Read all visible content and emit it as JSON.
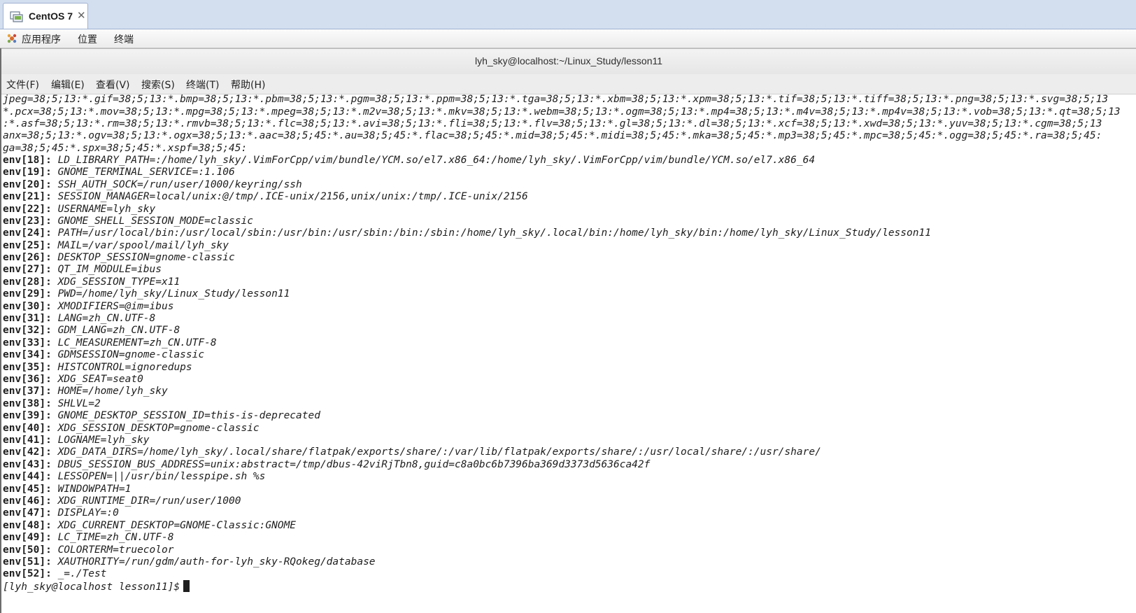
{
  "vm_tab": {
    "label": "CentOS 7",
    "close_glyph": "✕"
  },
  "gnome_topbar": {
    "menus": [
      {
        "label": "应用程序",
        "icon": "applications-icon"
      },
      {
        "label": "位置"
      },
      {
        "label": "终端"
      }
    ]
  },
  "window": {
    "title": "lyh_sky@localhost:~/Linux_Study/lesson11"
  },
  "menubar": {
    "items": [
      "文件(F)",
      "编辑(E)",
      "查看(V)",
      "搜索(S)",
      "终端(T)",
      "帮助(H)"
    ]
  },
  "terminal": {
    "wrapped_lines": [
      "jpeg=38;5;13:*.gif=38;5;13:*.bmp=38;5;13:*.pbm=38;5;13:*.pgm=38;5;13:*.ppm=38;5;13:*.tga=38;5;13:*.xbm=38;5;13:*.xpm=38;5;13:*.tif=38;5;13:*.tiff=38;5;13:*.png=38;5;13:*.svg=38;5;13",
      "*.pcx=38;5;13:*.mov=38;5;13:*.mpg=38;5;13:*.mpeg=38;5;13:*.m2v=38;5;13:*.mkv=38;5;13:*.webm=38;5;13:*.ogm=38;5;13:*.mp4=38;5;13:*.m4v=38;5;13:*.mp4v=38;5;13:*.vob=38;5;13:*.qt=38;5;13",
      ":*.asf=38;5;13:*.rm=38;5;13:*.rmvb=38;5;13:*.flc=38;5;13:*.avi=38;5;13:*.fli=38;5;13:*.flv=38;5;13:*.gl=38;5;13:*.dl=38;5;13:*.xcf=38;5;13:*.xwd=38;5;13:*.yuv=38;5;13:*.cgm=38;5;13",
      "anx=38;5;13:*.ogv=38;5;13:*.ogx=38;5;13:*.aac=38;5;45:*.au=38;5;45:*.flac=38;5;45:*.mid=38;5;45:*.midi=38;5;45:*.mka=38;5;45:*.mp3=38;5;45:*.mpc=38;5;45:*.ogg=38;5;45:*.ra=38;5;45:",
      "ga=38;5;45:*.spx=38;5;45:*.xspf=38;5;45:"
    ],
    "env_lines": [
      {
        "idx": "env[18]: ",
        "value": "LD_LIBRARY_PATH=:/home/lyh_sky/.VimForCpp/vim/bundle/YCM.so/el7.x86_64:/home/lyh_sky/.VimForCpp/vim/bundle/YCM.so/el7.x86_64"
      },
      {
        "idx": "env[19]: ",
        "value": "GNOME_TERMINAL_SERVICE=:1.106"
      },
      {
        "idx": "env[20]: ",
        "value": "SSH_AUTH_SOCK=/run/user/1000/keyring/ssh"
      },
      {
        "idx": "env[21]: ",
        "value": "SESSION_MANAGER=local/unix:@/tmp/.ICE-unix/2156,unix/unix:/tmp/.ICE-unix/2156"
      },
      {
        "idx": "env[22]: ",
        "value": "USERNAME=lyh_sky"
      },
      {
        "idx": "env[23]: ",
        "value": "GNOME_SHELL_SESSION_MODE=classic"
      },
      {
        "idx": "env[24]: ",
        "value": "PATH=/usr/local/bin:/usr/local/sbin:/usr/bin:/usr/sbin:/bin:/sbin:/home/lyh_sky/.local/bin:/home/lyh_sky/bin:/home/lyh_sky/Linux_Study/lesson11"
      },
      {
        "idx": "env[25]: ",
        "value": "MAIL=/var/spool/mail/lyh_sky"
      },
      {
        "idx": "env[26]: ",
        "value": "DESKTOP_SESSION=gnome-classic"
      },
      {
        "idx": "env[27]: ",
        "value": "QT_IM_MODULE=ibus"
      },
      {
        "idx": "env[28]: ",
        "value": "XDG_SESSION_TYPE=x11"
      },
      {
        "idx": "env[29]: ",
        "value": "PWD=/home/lyh_sky/Linux_Study/lesson11"
      },
      {
        "idx": "env[30]: ",
        "value": "XMODIFIERS=@im=ibus"
      },
      {
        "idx": "env[31]: ",
        "value": "LANG=zh_CN.UTF-8"
      },
      {
        "idx": "env[32]: ",
        "value": "GDM_LANG=zh_CN.UTF-8"
      },
      {
        "idx": "env[33]: ",
        "value": "LC_MEASUREMENT=zh_CN.UTF-8"
      },
      {
        "idx": "env[34]: ",
        "value": "GDMSESSION=gnome-classic"
      },
      {
        "idx": "env[35]: ",
        "value": "HISTCONTROL=ignoredups"
      },
      {
        "idx": "env[36]: ",
        "value": "XDG_SEAT=seat0"
      },
      {
        "idx": "env[37]: ",
        "value": "HOME=/home/lyh_sky"
      },
      {
        "idx": "env[38]: ",
        "value": "SHLVL=2"
      },
      {
        "idx": "env[39]: ",
        "value": "GNOME_DESKTOP_SESSION_ID=this-is-deprecated"
      },
      {
        "idx": "env[40]: ",
        "value": "XDG_SESSION_DESKTOP=gnome-classic"
      },
      {
        "idx": "env[41]: ",
        "value": "LOGNAME=lyh_sky"
      },
      {
        "idx": "env[42]: ",
        "value": "XDG_DATA_DIRS=/home/lyh_sky/.local/share/flatpak/exports/share/:/var/lib/flatpak/exports/share/:/usr/local/share/:/usr/share/"
      },
      {
        "idx": "env[43]: ",
        "value": "DBUS_SESSION_BUS_ADDRESS=unix:abstract=/tmp/dbus-42viRjTbn8,guid=c8a0bc6b7396ba369d3373d5636ca42f"
      },
      {
        "idx": "env[44]: ",
        "value": "LESSOPEN=||/usr/bin/lesspipe.sh %s"
      },
      {
        "idx": "env[45]: ",
        "value": "WINDOWPATH=1"
      },
      {
        "idx": "env[46]: ",
        "value": "XDG_RUNTIME_DIR=/run/user/1000"
      },
      {
        "idx": "env[47]: ",
        "value": "DISPLAY=:0"
      },
      {
        "idx": "env[48]: ",
        "value": "XDG_CURRENT_DESKTOP=GNOME-Classic:GNOME"
      },
      {
        "idx": "env[49]: ",
        "value": "LC_TIME=zh_CN.UTF-8"
      },
      {
        "idx": "env[50]: ",
        "value": "COLORTERM=truecolor"
      },
      {
        "idx": "env[51]: ",
        "value": "XAUTHORITY=/run/gdm/auth-for-lyh_sky-RQokeg/database"
      },
      {
        "idx": "env[52]: ",
        "value": "_=./Test"
      }
    ],
    "prompt": "[lyh_sky@localhost lesson11]$"
  },
  "colors": {
    "tabbar_bg": "#d3deef",
    "terminal_bg": "#ffffff",
    "terminal_fg": "#1e1e1e"
  }
}
